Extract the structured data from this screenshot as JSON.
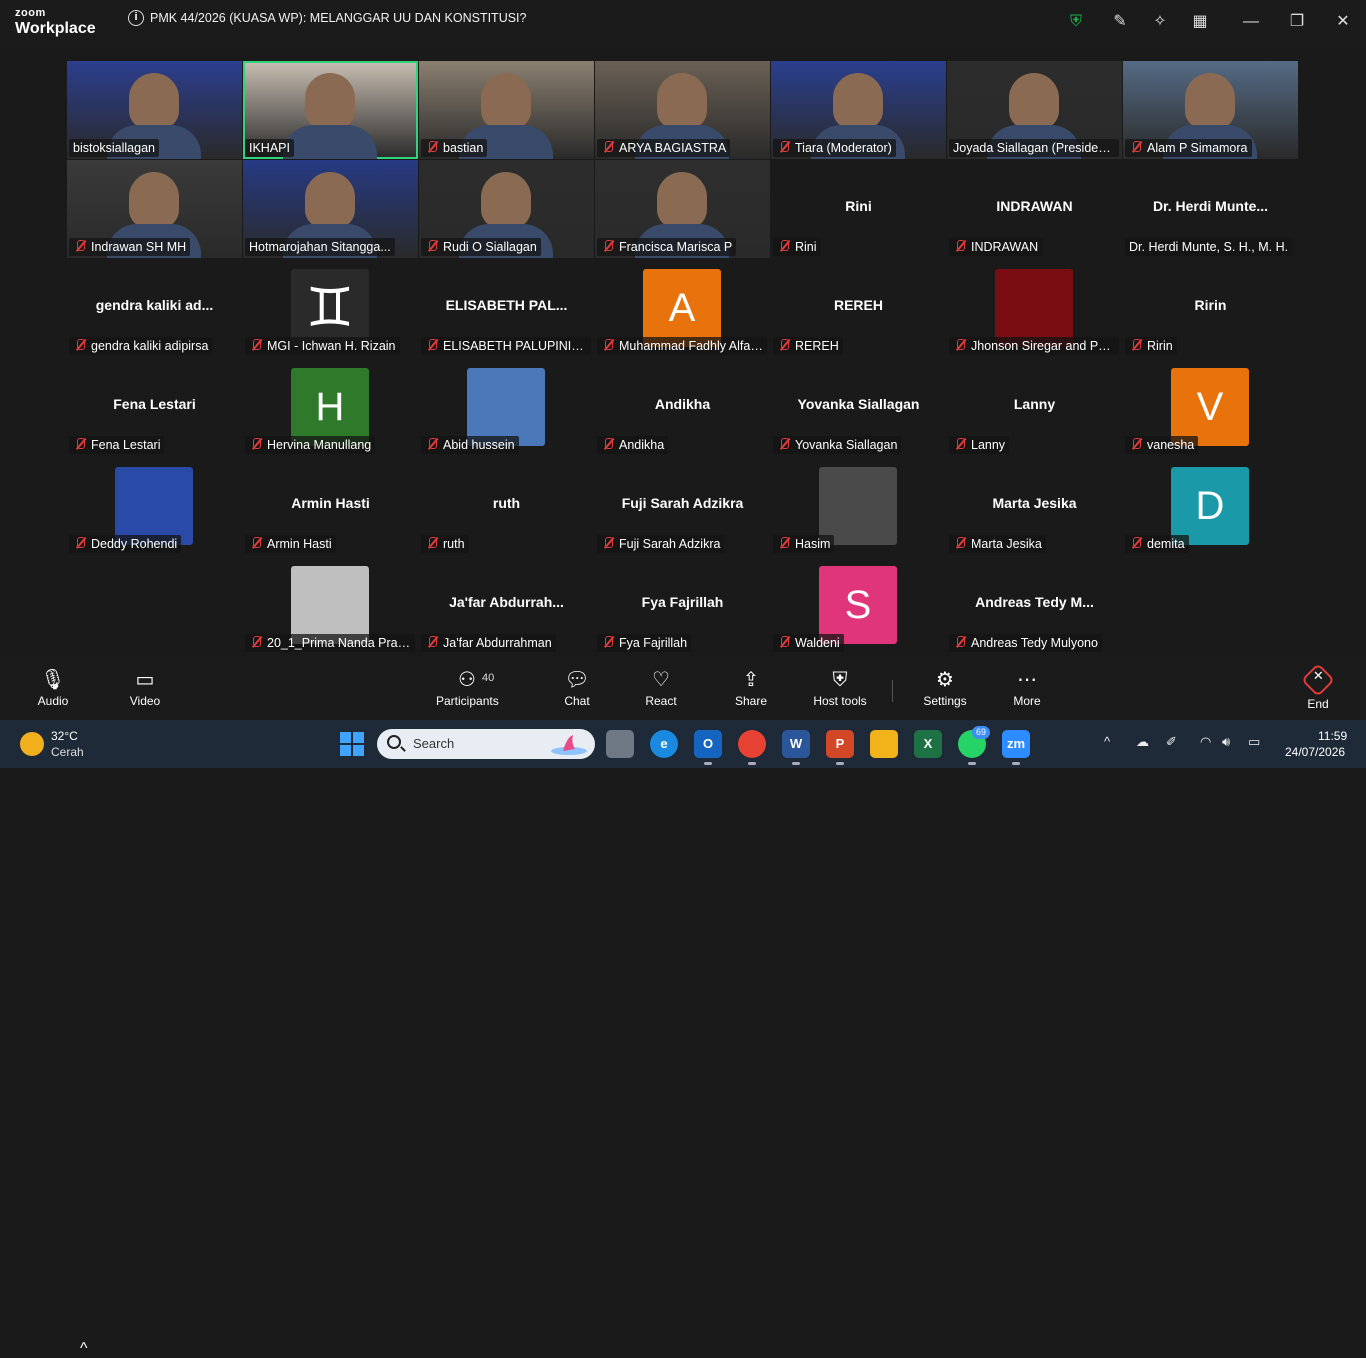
{
  "app": {
    "logo_line1": "zoom",
    "logo_line2": "Workplace",
    "meeting_title": "PMK 44/2026 (KUASA WP): MELANGGAR UU DAN KONSTITUSI?",
    "info_glyph": "i"
  },
  "titlebar_icons": [
    "shield-icon",
    "annotate-icon",
    "sparkle-icon",
    "apps-grid-icon",
    "minimize-icon",
    "maximize-icon",
    "close-icon"
  ],
  "accent_colors": {
    "speaking": "#2fd47d",
    "muted": "#e23b3b",
    "shield": "#19b34a"
  },
  "participants": [
    {
      "name": "bistoksiallagan",
      "kind": "video",
      "muted": false,
      "bg": "#2c3e8f"
    },
    {
      "name": "IKHAPI",
      "kind": "video",
      "muted": false,
      "bg": "#c9bfb3",
      "speaking": true
    },
    {
      "name": "bastian",
      "kind": "video",
      "muted": true,
      "bg": "#8a7f70"
    },
    {
      "name": "ARYA BAGIASTRA",
      "kind": "video",
      "muted": true,
      "bg": "#6a6055"
    },
    {
      "name": "Tiara (Moderator)",
      "kind": "video",
      "muted": true,
      "bg": "#2a3f8f"
    },
    {
      "name": "Joyada Siallagan (President...",
      "kind": "video",
      "muted": false,
      "bg": "#2c2c2c"
    },
    {
      "name": "Alam P Simamora",
      "kind": "video",
      "muted": true,
      "bg": "#556b85"
    },
    {
      "name": "Indrawan SH MH",
      "kind": "video",
      "muted": true,
      "bg": "#3a3a3a"
    },
    {
      "name": "Hotmarojahan Sitangga...",
      "kind": "video",
      "muted": false,
      "bg": "#273a84"
    },
    {
      "name": "Rudi O Siallagan",
      "kind": "video",
      "muted": true,
      "bg": "#2c2c2c"
    },
    {
      "name": "Francisca Marisca P",
      "kind": "video",
      "muted": true,
      "bg": "#2e2e2e"
    },
    {
      "name": "Rini",
      "kind": "name",
      "muted": true,
      "label": "Rini"
    },
    {
      "name": "INDRAWAN",
      "kind": "name",
      "muted": true,
      "label": "INDRAWAN"
    },
    {
      "name": "Dr. Herdi Munte, S. H., M. H.",
      "kind": "name",
      "muted": false,
      "label": "Dr. Herdi Munte..."
    },
    {
      "name": "gendra kaliki adipirsa",
      "kind": "name",
      "muted": true,
      "label": "gendra kaliki ad..."
    },
    {
      "name": "MGI - Ichwan H. Rizain",
      "kind": "avatar-glyph",
      "muted": true,
      "glyph": "♊",
      "avatar_bg": "#2a2a2a"
    },
    {
      "name": "ELISABETH PALUPINING...",
      "kind": "name",
      "muted": true,
      "label": "ELISABETH PAL..."
    },
    {
      "name": "Muhammad Fadhly Alfar...",
      "kind": "avatar-letter",
      "muted": true,
      "letter": "A",
      "avatar_bg": "#e8720c"
    },
    {
      "name": "REREH",
      "kind": "name",
      "muted": true,
      "label": "REREH"
    },
    {
      "name": "Jhonson Siregar and Pa...",
      "kind": "avatar-color",
      "muted": true,
      "avatar_bg": "#7a0d12"
    },
    {
      "name": "Ririn",
      "kind": "name",
      "muted": true,
      "label": "Ririn"
    },
    {
      "name": "Fena Lestari",
      "kind": "name",
      "muted": true,
      "label": "Fena Lestari"
    },
    {
      "name": "Hervina Manullang",
      "kind": "avatar-letter",
      "muted": true,
      "letter": "H",
      "avatar_bg": "#2f7a2a"
    },
    {
      "name": "Abid hussein",
      "kind": "avatar-color",
      "muted": true,
      "avatar_bg": "#4a78b8"
    },
    {
      "name": "Andikha",
      "kind": "name",
      "muted": true,
      "label": "Andikha"
    },
    {
      "name": "Yovanka Siallagan",
      "kind": "name",
      "muted": true,
      "label": "Yovanka Siallagan"
    },
    {
      "name": "Lanny",
      "kind": "name",
      "muted": true,
      "label": "Lanny"
    },
    {
      "name": "vanesha",
      "kind": "avatar-letter",
      "muted": true,
      "letter": "V",
      "avatar_bg": "#e8720c"
    },
    {
      "name": "Deddy Rohendi",
      "kind": "avatar-color",
      "muted": true,
      "avatar_bg": "#2a4aa8"
    },
    {
      "name": "Armin Hasti",
      "kind": "name",
      "muted": true,
      "label": "Armin Hasti"
    },
    {
      "name": "ruth",
      "kind": "name",
      "muted": true,
      "label": "ruth"
    },
    {
      "name": "Fuji Sarah Adzikra",
      "kind": "name",
      "muted": true,
      "label": "Fuji Sarah Adzikra"
    },
    {
      "name": "Hasim",
      "kind": "avatar-color",
      "muted": true,
      "avatar_bg": "#4a4a4a"
    },
    {
      "name": "Marta Jesika",
      "kind": "name",
      "muted": true,
      "label": "Marta Jesika"
    },
    {
      "name": "demita",
      "kind": "avatar-letter",
      "muted": true,
      "letter": "D",
      "avatar_bg": "#1a9aa8"
    },
    {
      "name": "20_1_Prima Nanda Pras...",
      "kind": "avatar-color",
      "muted": true,
      "avatar_bg": "#bfbfbf"
    },
    {
      "name": "Ja'far Abdurrahman",
      "kind": "name",
      "muted": true,
      "label": "Ja'far Abdurrah..."
    },
    {
      "name": "Fya Fajrillah",
      "kind": "name",
      "muted": true,
      "label": "Fya Fajrillah"
    },
    {
      "name": "Waldeni",
      "kind": "avatar-letter",
      "muted": true,
      "letter": "S",
      "avatar_bg": "#e0357a"
    },
    {
      "name": "Andreas Tedy Mulyono",
      "kind": "name",
      "muted": true,
      "label": "Andreas Tedy M..."
    }
  ],
  "toolbar": {
    "audio": "Audio",
    "video": "Video",
    "participants": "Participants",
    "participants_count": "40",
    "chat": "Chat",
    "react": "React",
    "share": "Share",
    "host_tools": "Host tools",
    "settings": "Settings",
    "more": "More",
    "end": "End"
  },
  "taskbar": {
    "temp": "32°C",
    "weather": "Cerah",
    "search_placeholder": "Search",
    "apps": [
      {
        "name": "file-explorer-gray",
        "label": "",
        "color": "#6f7885"
      },
      {
        "name": "edge",
        "label": "e",
        "color": "#1a8ae0"
      },
      {
        "name": "outlook",
        "label": "O",
        "color": "#1565c0"
      },
      {
        "name": "chrome",
        "label": "",
        "color": "#e84235"
      },
      {
        "name": "word",
        "label": "W",
        "color": "#2b579a"
      },
      {
        "name": "powerpoint",
        "label": "P",
        "color": "#d24726"
      },
      {
        "name": "folder",
        "label": "",
        "color": "#f2b31a"
      },
      {
        "name": "excel",
        "label": "X",
        "color": "#1e7145"
      },
      {
        "name": "whatsapp",
        "label": "",
        "color": "#25d366"
      },
      {
        "name": "zoom",
        "label": "zm",
        "color": "#2d8cff"
      }
    ],
    "whatsapp_badge": "69",
    "time": "11:59",
    "date": "24/07/2026"
  }
}
